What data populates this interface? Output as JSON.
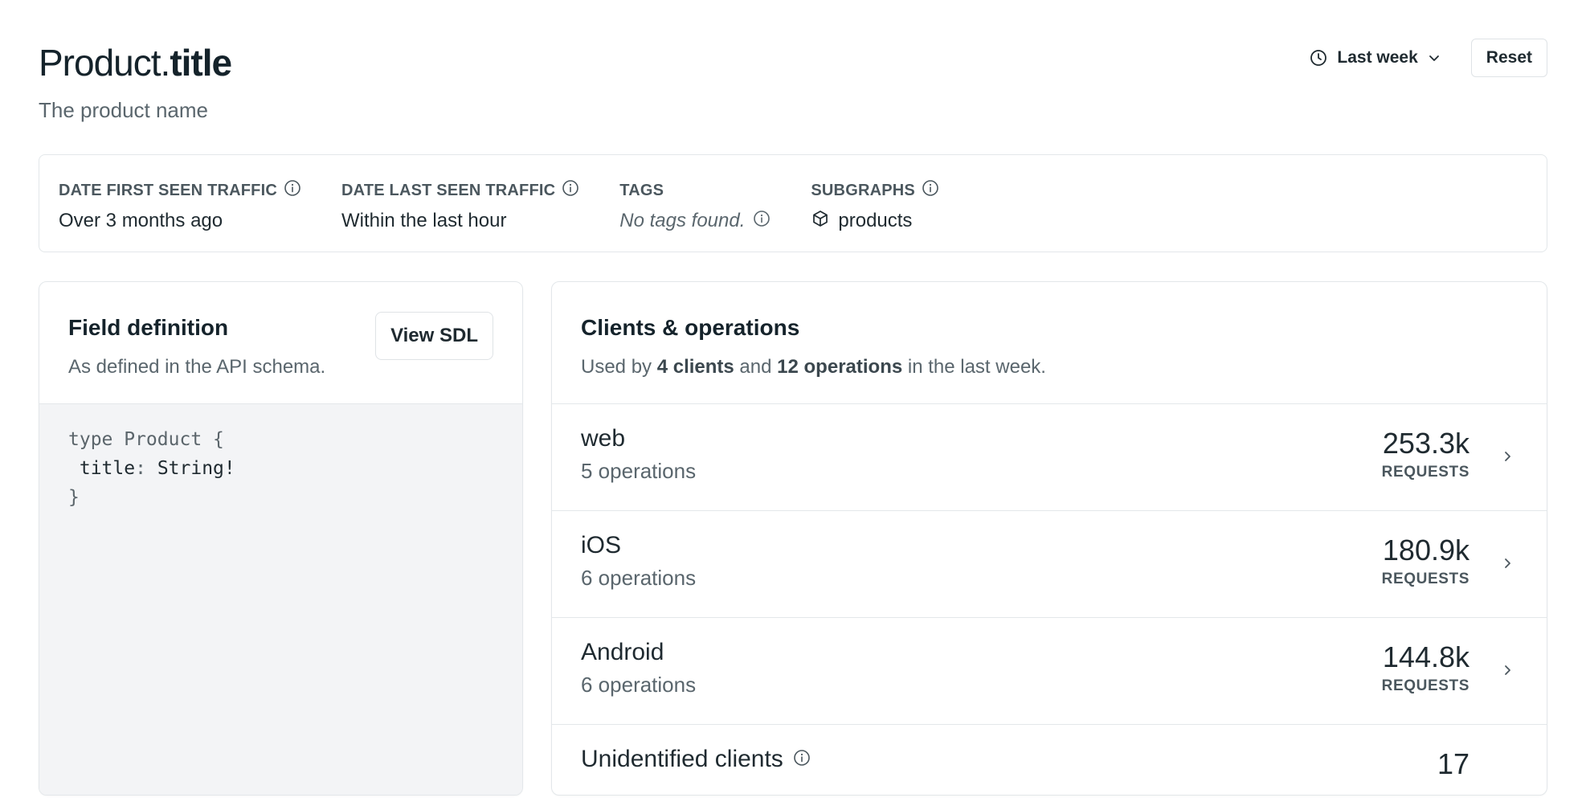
{
  "header": {
    "title_type": "Product.",
    "title_field": "title",
    "subtitle": "The product name",
    "range_label": "Last week",
    "reset_label": "Reset"
  },
  "meta": {
    "first_seen": {
      "label": "DATE FIRST SEEN TRAFFIC",
      "value": "Over 3 months ago"
    },
    "last_seen": {
      "label": "DATE LAST SEEN TRAFFIC",
      "value": "Within the last hour"
    },
    "tags": {
      "label": "TAGS",
      "value": "No tags found."
    },
    "subgraphs": {
      "label": "SUBGRAPHS",
      "value": "products"
    }
  },
  "field_card": {
    "title": "Field definition",
    "description": "As defined in the API schema.",
    "view_sdl_label": "View SDL",
    "code": {
      "line1": "type Product {",
      "field_name": "title",
      "field_sep": ": ",
      "field_type": "String!",
      "line3": "}"
    }
  },
  "clients_card": {
    "title": "Clients & operations",
    "desc_prefix": "Used by ",
    "desc_clients": "4 clients",
    "desc_mid": " and ",
    "desc_ops": "12 operations",
    "desc_suffix": " in the last week.",
    "clients": [
      {
        "name": "web",
        "operations": "5 operations",
        "requests": "253.3k",
        "unit": "REQUESTS"
      },
      {
        "name": "iOS",
        "operations": "6 operations",
        "requests": "180.9k",
        "unit": "REQUESTS"
      },
      {
        "name": "Android",
        "operations": "6 operations",
        "requests": "144.8k",
        "unit": "REQUESTS"
      },
      {
        "name": "Unidentified clients",
        "operations": "",
        "requests": "17",
        "unit": ""
      }
    ]
  },
  "colors": {
    "text": "#1f2a30",
    "muted": "#5a666d",
    "border": "#e3e7ea",
    "code_bg": "#f3f4f6"
  },
  "icons": {
    "range": "clock-icon",
    "range_caret": "chevron-down-icon",
    "info": "info-icon",
    "subgraph": "cube-icon",
    "row": "chevron-right-icon"
  }
}
